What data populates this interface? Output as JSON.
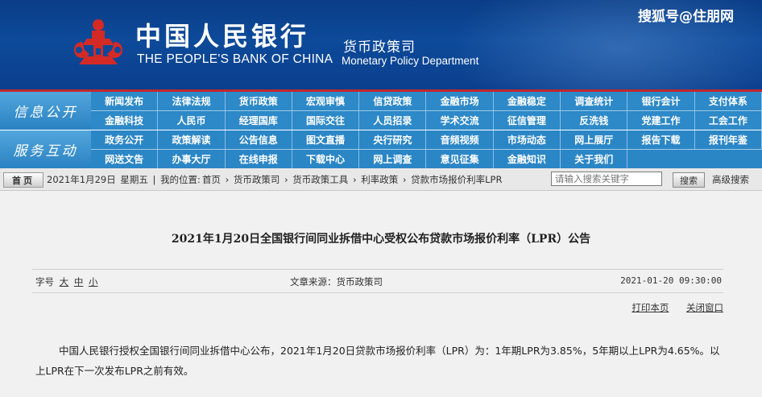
{
  "header": {
    "bank_name_cn": "中国人民银行",
    "bank_name_en": "THE PEOPLE'S BANK OF CHINA",
    "dept_cn": "货币政策司",
    "dept_en": "Monetary Policy Department",
    "watermark": "搜狐号@住朋网",
    "logo_icon": "pboc-logo-icon",
    "colors": {
      "header_blue": "#0d4a9a",
      "logo_red": "#d42a26",
      "nav_blue": "#2d89c8",
      "divider_red": "#c0272d"
    }
  },
  "nav": {
    "section1_label": "信息公开",
    "section2_label": "服务互动",
    "row1": [
      "新闻发布",
      "法律法规",
      "货币政策",
      "宏观审慎",
      "信贷政策",
      "金融市场",
      "金融稳定",
      "调查统计",
      "银行会计",
      "支付体系"
    ],
    "row2": [
      "金融科技",
      "人民币",
      "经理国库",
      "国际交往",
      "人员招录",
      "学术交流",
      "征信管理",
      "反洗钱",
      "党建工作",
      "工会工作"
    ],
    "row3": [
      "政务公开",
      "政策解读",
      "公告信息",
      "图文直播",
      "央行研究",
      "音频视频",
      "市场动态",
      "网上展厅",
      "报告下载",
      "报刊年鉴"
    ],
    "row4": [
      "网送文告",
      "办事大厅",
      "在线申报",
      "下载中心",
      "网上调查",
      "意见征集",
      "金融知识",
      "关于我们"
    ]
  },
  "crumb": {
    "home": "首页",
    "date": "2021年1月29日",
    "weekday": "星期五",
    "sep": "|",
    "location_label": "我的位置:",
    "items": [
      "首页",
      "货币政策司",
      "货币政策工具",
      "利率政策",
      "贷款市场报价利率LPR"
    ],
    "arrow": "›",
    "search_placeholder": "请输入搜索关键字",
    "search_button": "搜索",
    "advanced_search": "高级搜索"
  },
  "article": {
    "title": "2021年1月20日全国银行间同业拆借中心受权公布贷款市场报价利率（LPR）公告",
    "font_size_label": "字号",
    "font_large": "大",
    "font_medium": "中",
    "font_small": "小",
    "source": "文章来源：货币政策司",
    "pub_time": "2021-01-20 09:30:00",
    "print": "打印本页",
    "close": "关闭窗口",
    "body": "中国人民银行授权全国银行间同业拆借中心公布，2021年1月20日贷款市场报价利率（LPR）为：1年期LPR为3.85%，5年期以上LPR为4.65%。以上LPR在下一次发布LPR之前有效。"
  }
}
